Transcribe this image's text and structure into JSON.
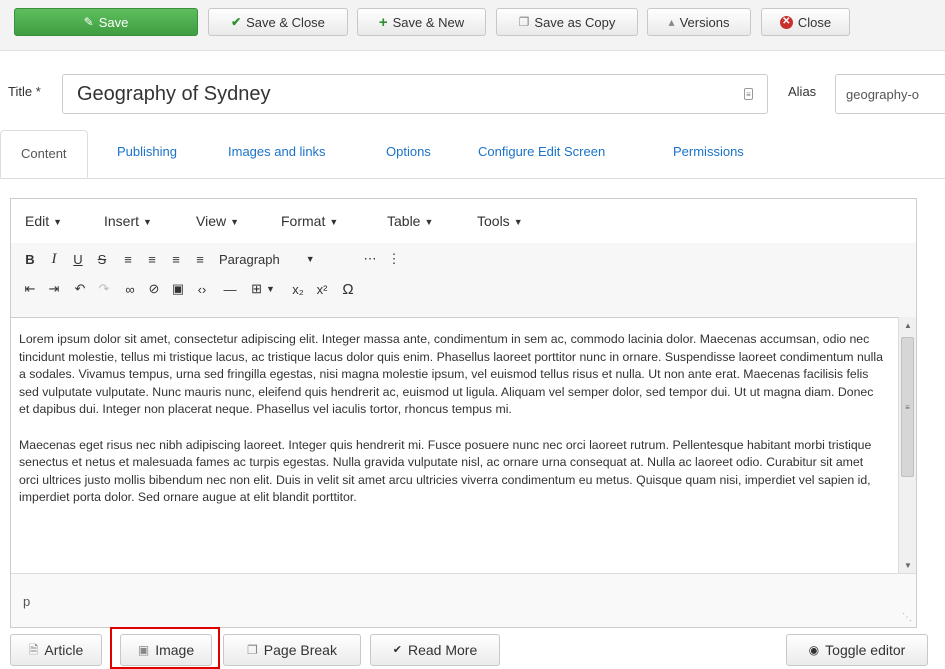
{
  "toolbar": {
    "save": "Save",
    "save_close": "Save & Close",
    "save_new": "Save & New",
    "save_copy": "Save as Copy",
    "versions": "Versions",
    "close": "Close"
  },
  "title": {
    "label": "Title *",
    "value": "Geography of Sydney"
  },
  "alias": {
    "label": "Alias",
    "value": "geography-o"
  },
  "tabs": [
    "Content",
    "Publishing",
    "Images and links",
    "Options",
    "Configure Edit Screen",
    "Permissions"
  ],
  "editor": {
    "menus": [
      "Edit",
      "Insert",
      "View",
      "Format",
      "Table",
      "Tools"
    ],
    "format_select": "Paragraph",
    "paragraph1": "Lorem ipsum dolor sit amet, consectetur adipiscing elit. Integer massa ante, condimentum in sem ac, commodo lacinia dolor. Maecenas accumsan, odio nec tincidunt molestie, tellus mi tristique lacus, ac tristique lacus dolor quis enim. Phasellus laoreet porttitor nunc in ornare. Suspendisse laoreet condimentum nulla a sodales. Vivamus tempus, urna sed fringilla egestas, nisi magna molestie ipsum, vel euismod tellus risus et nulla. Ut non ante erat. Maecenas facilisis felis sed vulputate vulputate. Nunc mauris nunc, eleifend quis hendrerit ac, euismod ut ligula. Aliquam vel semper dolor, sed tempor dui. Ut ut magna diam. Donec et dapibus dui. Integer non placerat neque. Phasellus vel iaculis tortor, rhoncus tempus mi.",
    "paragraph2": "Maecenas eget risus nec nibh adipiscing laoreet. Integer quis hendrerit mi. Fusce posuere nunc nec orci laoreet rutrum. Pellentesque habitant morbi tristique senectus et netus et malesuada fames ac turpis egestas. Nulla gravida vulputate nisl, ac ornare urna consequat at. Nulla ac laoreet odio. Curabitur sit amet orci ultrices justo mollis bibendum nec non elit. Duis in velit sit amet arcu ultricies viverra condimentum eu metus. Quisque quam nisi, imperdiet vel sapien id, imperdiet porta dolor. Sed ornare augue at elit blandit porttitor.",
    "status_path": "p"
  },
  "bottom_buttons": {
    "article": "Article",
    "image": "Image",
    "page_break": "Page Break",
    "read_more": "Read More",
    "toggle_editor": "Toggle editor"
  },
  "colors": {
    "save_green": "#4cae4c",
    "link_blue": "#1a73c8",
    "highlight_red": "#e00000"
  }
}
